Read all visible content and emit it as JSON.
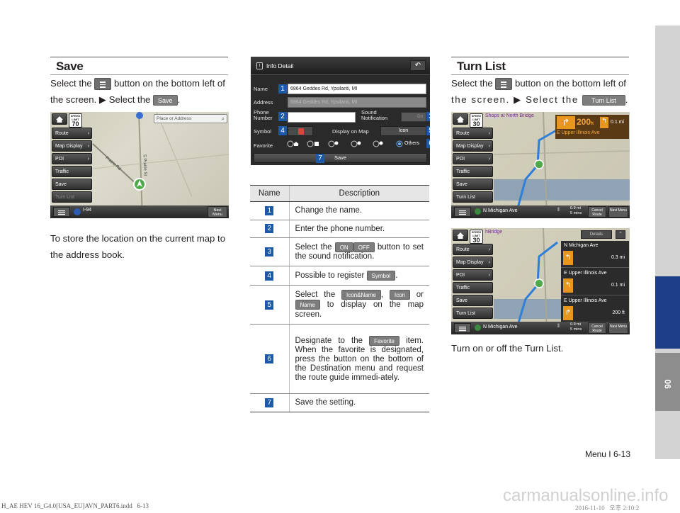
{
  "save_section": {
    "title": "Save",
    "intro_a": "Select the",
    "intro_b": "button on the bottom left of",
    "intro_c": "the screen. ▶ Select the",
    "save_chip": "Save",
    "desc_line1": "To store the location on the current map to",
    "desc_line2": "the address book.",
    "screenshot": {
      "search_placeholder": "Place or Address",
      "speed_label": "SPEED LIMIT",
      "speed_value": "70",
      "menu": [
        "Route",
        "Map Display",
        "POI",
        "Traffic",
        "Save",
        "Turn List"
      ],
      "road_label": "I-94",
      "navi_menu": "Navi Menu",
      "street_a": "Prairie Rd",
      "street_b": "S Prairie St"
    }
  },
  "info_detail": {
    "title": "Info Detail",
    "name_label": "Name",
    "name_value": "6864 Geddes Rd, Ypsilanti, MI",
    "address_label": "Address",
    "address_value": "6864 Geddes Rd, Ypsilanti, MI",
    "phone_label": "Phone Number",
    "sound_label": "Sound Notification",
    "sound_toggle": "On",
    "symbol_label": "Symbol",
    "display_on_map_label": "Display on Map",
    "display_value": "Icon",
    "favorite_label": "Favorite",
    "favorite_others": "Others",
    "save_button": "Save",
    "badges": [
      "1",
      "2",
      "3",
      "4",
      "5",
      "6",
      "7"
    ]
  },
  "table": {
    "col_name": "Name",
    "col_desc": "Description",
    "rows": [
      {
        "num": "1",
        "text": "Change the name."
      },
      {
        "num": "2",
        "text": "Enter the phone number."
      },
      {
        "num": "3",
        "pre": "Select the",
        "chip1": "ON",
        "chip2": "OFF",
        "post": "button to set the sound notification."
      },
      {
        "num": "4",
        "pre": "Possible to register",
        "chip1": "Symbol",
        "post": "."
      },
      {
        "num": "5",
        "pre": "Select the",
        "chip1": "Icon&Name",
        "mid": ",",
        "chip2": "Icon",
        "mid2": "or",
        "chip3": "Name",
        "post": "to display on the map screen."
      },
      {
        "num": "6",
        "pre": "Designate to the",
        "chip1": "Favorite",
        "post": "item. When the favorite is designated, press the button on the bottom of the Destination menu and request the route guide immedi-ately."
      },
      {
        "num": "7",
        "text": "Save the setting."
      }
    ]
  },
  "turn_list_section": {
    "title": "Turn List",
    "intro_a": "Select the",
    "intro_b": "button on the bottom left of",
    "intro_c": "the screen. ▶ Select the",
    "chip": "Turn List",
    "desc": "Turn on or off the Turn List.",
    "screenshot1": {
      "poi_label": "Shops at North Bridge",
      "speed_label": "SPEED LIMIT",
      "speed_value": "30",
      "distance": "200",
      "distance_unit": "ft",
      "next_turn": "0.1 mi",
      "street": "E Upper Illinois Ave",
      "menu": [
        "Route",
        "Map Display",
        "POI",
        "Traffic",
        "Save",
        "Turn List"
      ],
      "current_road": "N Michigan Ave",
      "eta_dist": "0.9 mi",
      "eta_time": "5 mins",
      "cancel_route": "Cancel Route",
      "navi_menu": "Navi Menu"
    },
    "screenshot2": {
      "poi_label": "hBridge",
      "speed_label": "SPEED LIMIT",
      "speed_value": "30",
      "details_btn": "Details",
      "turns": [
        {
          "street": "N Michigan Ave",
          "dist": "0.3 mi"
        },
        {
          "street": "E Upper Illinois Ave",
          "dist": "0.1 mi"
        },
        {
          "street": "E Upper Illinois Ave",
          "dist": "200 ft"
        }
      ],
      "menu": [
        "Route",
        "Map Display",
        "POI",
        "Traffic",
        "Save",
        "Turn List"
      ],
      "current_road": "N Michigan Ave",
      "eta_dist": "0.9 mi",
      "eta_time": "5 mins",
      "cancel_route": "Cancel Route",
      "navi_menu": "Navi Menu"
    }
  },
  "footer": {
    "page_label": "Menu I 6-13",
    "chapter": "06",
    "print_info": "H_AE HEV 16_G4.0[USA_EU]AVN_PART6.indd   6-13",
    "print_date": "2016-11-10   오후 2:10:2",
    "watermark": "carmanualsonline.info"
  },
  "colors": {
    "badge_blue": "#1c5aa8",
    "side_tab_blue": "#1d3f87",
    "route_blue": "#2e7fd9",
    "turn_orange": "#e8961e"
  }
}
